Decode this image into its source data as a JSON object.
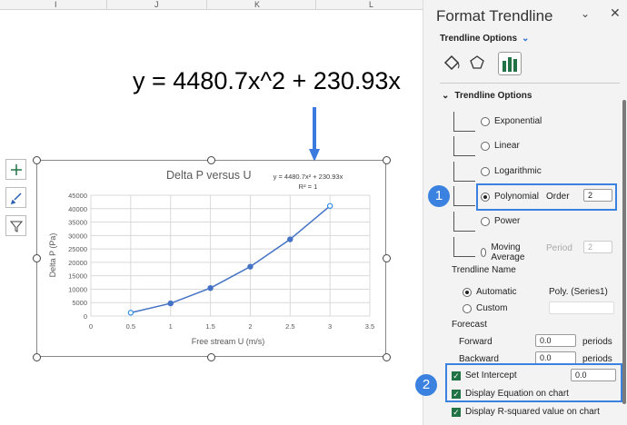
{
  "columns": [
    "I",
    "J",
    "K",
    "L"
  ],
  "annotation_equation": "y = 4480.7x^2 + 230.93x",
  "chart_tools": [
    "plus-icon",
    "brush-icon",
    "filter-icon"
  ],
  "chart_data": {
    "type": "scatter",
    "title": "Delta P versus U",
    "xlabel": "Free stream U (m/s)",
    "ylabel": "Delta P (Pa)",
    "xlim": [
      0,
      3.5
    ],
    "ylim": [
      0,
      45000
    ],
    "xticks": [
      "0",
      "0.5",
      "1",
      "1.5",
      "2",
      "2.5",
      "3",
      "3.5"
    ],
    "yticks": [
      "0",
      "5000",
      "10000",
      "15000",
      "20000",
      "25000",
      "30000",
      "35000",
      "40000",
      "45000"
    ],
    "x": [
      0.5,
      1,
      1.5,
      2,
      2.5,
      3
    ],
    "y": [
      1236,
      4712,
      10428,
      18385,
      28582,
      41019
    ],
    "grid": true,
    "trendline": {
      "type": "polynomial",
      "order": 2,
      "equation": "y = 4480.7x² + 230.93x",
      "r2": "R² = 1"
    },
    "color": "#4472c4"
  },
  "panel": {
    "title": "Format Trendline",
    "section_dropdown": "Trendline Options",
    "section_title": "Trendline Options",
    "types": [
      {
        "label": "Exponential",
        "selected": false
      },
      {
        "label": "Linear",
        "selected": false
      },
      {
        "label": "Logarithmic",
        "selected": false
      },
      {
        "label": "Polynomial",
        "selected": true
      },
      {
        "label": "Power",
        "selected": false
      },
      {
        "label": "Moving Average",
        "selected": false
      }
    ],
    "order_label": "Order",
    "order_value": "2",
    "period_label": "Period",
    "period_value": "2",
    "name_label": "Trendline Name",
    "automatic_label": "Automatic",
    "automatic_value": "Poly. (Series1)",
    "custom_label": "Custom",
    "forecast_label": "Forecast",
    "forward_label": "Forward",
    "forward_value": "0.0",
    "backward_label": "Backward",
    "backward_value": "0.0",
    "periods": "periods",
    "set_intercept_label": "Set Intercept",
    "set_intercept_value": "0.0",
    "display_equation_label": "Display Equation on chart",
    "display_r2_label": "Display R-squared value on chart",
    "badge1": "1",
    "badge2": "2"
  }
}
